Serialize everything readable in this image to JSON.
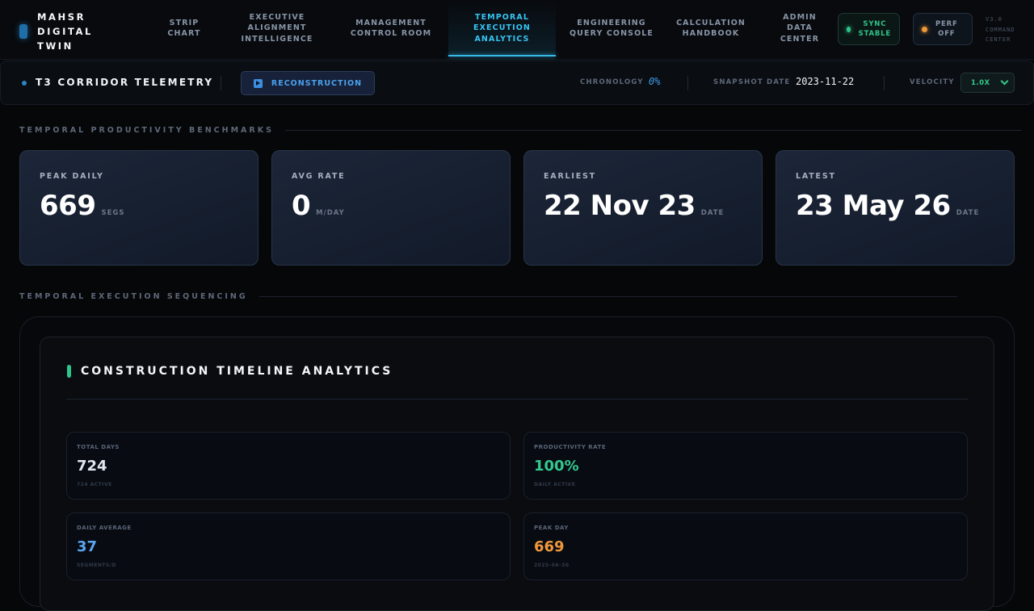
{
  "brand": {
    "line1": "MAHSR",
    "line2": "DIGITAL",
    "line3": "TWIN"
  },
  "nav": [
    {
      "l1": "STRIP",
      "l2": "CHART",
      "l3": ""
    },
    {
      "l1": "EXECUTIVE",
      "l2": "ALIGNMENT",
      "l3": "INTELLIGENCE"
    },
    {
      "l1": "MANAGEMENT",
      "l2": "CONTROL ROOM",
      "l3": ""
    },
    {
      "l1": "TEMPORAL",
      "l2": "EXECUTION",
      "l3": "ANALYTICS"
    },
    {
      "l1": "ENGINEERING",
      "l2": "QUERY CONSOLE",
      "l3": ""
    },
    {
      "l1": "CALCULATION",
      "l2": "HANDBOOK",
      "l3": ""
    },
    {
      "l1": "ADMIN",
      "l2": "DATA",
      "l3": "CENTER"
    }
  ],
  "status": {
    "sync_l1": "SYNC",
    "sync_l2": "STABLE",
    "perf_l1": "PERF",
    "perf_l2": "OFF",
    "version_l1": "V3.0",
    "version_l2": "COMMAND",
    "version_l3": "CENTER"
  },
  "telemetry": {
    "title": "T3 CORRIDOR TELEMETRY",
    "reconstruction": "RECONSTRUCTION",
    "chronology_label": "CHRONOLOGY",
    "chronology_value": "0%",
    "snapshot_label": "SNAPSHOT DATE",
    "snapshot_value": "2023-11-22",
    "velocity_label": "VELOCITY",
    "velocity_value": "1.0X"
  },
  "benchmarks": {
    "heading": "TEMPORAL PRODUCTIVITY BENCHMARKS",
    "cards": [
      {
        "label": "PEAK DAILY",
        "value": "669",
        "unit": "SEGS"
      },
      {
        "label": "AVG RATE",
        "value": "0",
        "unit": "M/DAY"
      },
      {
        "label": "EARLIEST",
        "value": "22 Nov 23",
        "unit": "DATE"
      },
      {
        "label": "LATEST",
        "value": "23 May 26",
        "unit": "DATE"
      }
    ]
  },
  "sequencing": {
    "heading": "TEMPORAL EXECUTION SEQUENCING",
    "panel_title": "CONSTRUCTION TIMELINE ANALYTICS",
    "stats": [
      {
        "label": "TOTAL DAYS",
        "value": "724",
        "sub": "724 ACTIVE",
        "color": "#dfe6ef"
      },
      {
        "label": "PRODUCTIVITY RATE",
        "value": "100%",
        "sub": "DAILY ACTIVE",
        "color": "#33c98e"
      },
      {
        "label": "DAILY AVERAGE",
        "value": "37",
        "sub": "SEGMENTS/D",
        "color": "#5aa6f0"
      },
      {
        "label": "PEAK DAY",
        "value": "669",
        "sub": "2025-06-30",
        "color": "#f0983a"
      }
    ]
  },
  "colors": {
    "accent": "#36b8e8",
    "success": "#2fc48a",
    "warning": "#f0983a",
    "sync_dot": "#2fc48a",
    "perf_dot": "#f0983a"
  }
}
